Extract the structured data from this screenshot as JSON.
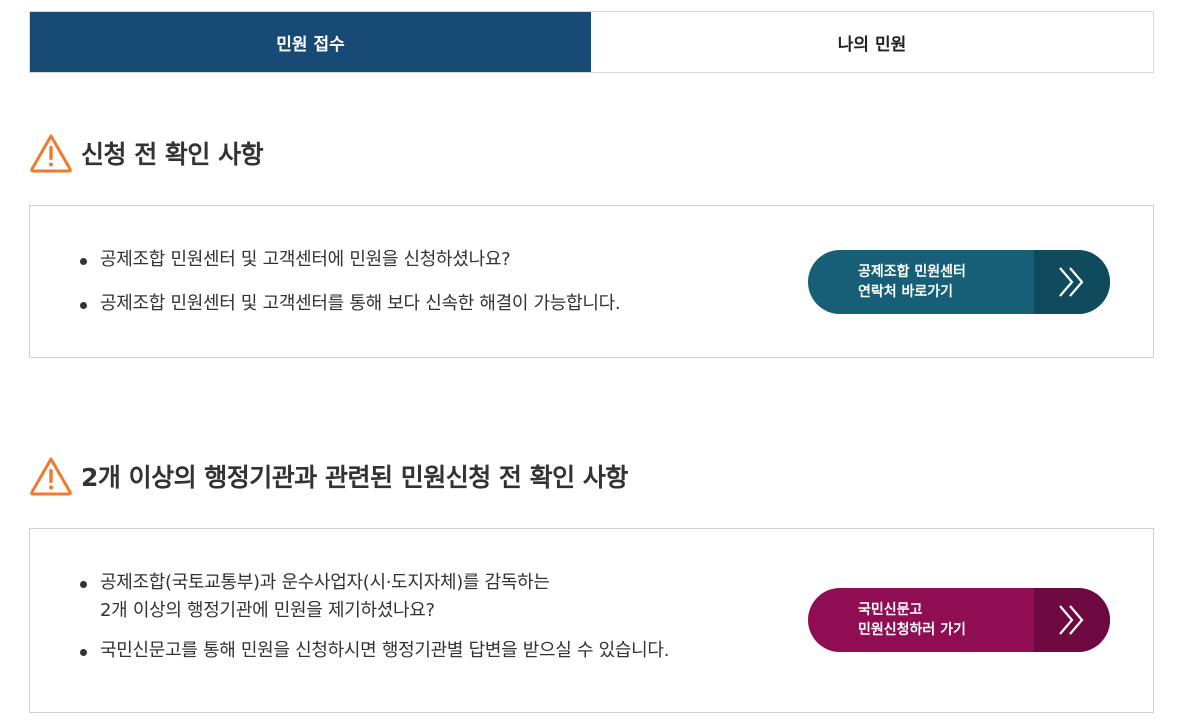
{
  "tabs": [
    {
      "label": "민원 접수",
      "active": true
    },
    {
      "label": "나의 민원",
      "active": false
    }
  ],
  "section1": {
    "icon": "warning-icon",
    "title": "신청 전 확인 사항",
    "bullets": [
      "공제조합 민원센터 및 고객센터에 민원을 신청하셨나요?",
      "공제조합 민원센터 및 고객센터를 통해 보다 신속한 해결이 가능합니다."
    ],
    "button": {
      "line1": "공제조합 민원센터",
      "line2": "연락처 바로가기",
      "icon": "double-chevron-right-icon",
      "color": "#175f76"
    }
  },
  "section2": {
    "icon": "warning-icon",
    "title": "2개 이상의 행정기관과 관련된 민원신청 전 확인 사항",
    "bullet1_line1": "공제조합(국토교통부)과 운수사업자(시·도지자체)를 감독하는",
    "bullet1_line2": "2개 이상의 행정기관에 민원을 제기하셨나요?",
    "bullet2": "국민신문고를 통해 민원을 신청하시면 행정기관별 답변을 받으실 수 있습니다.",
    "button": {
      "line1": "국민신문고",
      "line2": "민원신청하러 가기",
      "icon": "double-chevron-right-icon",
      "color": "#8f0d52"
    }
  },
  "colors": {
    "tab_active": "#174a74",
    "warning": "#f07a2e"
  }
}
